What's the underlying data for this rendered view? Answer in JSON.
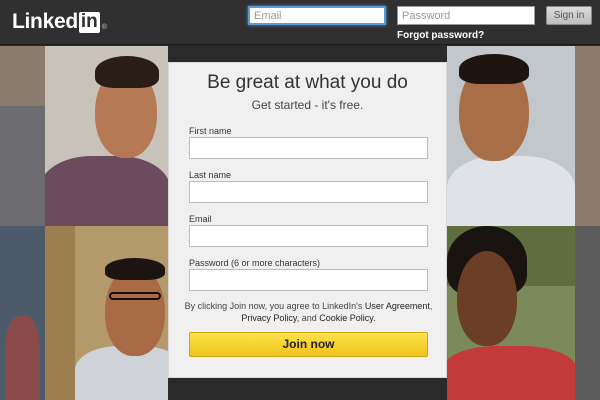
{
  "header": {
    "logo_text": "Linked",
    "logo_in": "in",
    "logo_reg": "®",
    "email_placeholder": "Email",
    "password_placeholder": "Password",
    "signin_label": "Sign in",
    "forgot_label": "Forgot password?"
  },
  "signup": {
    "title": "Be great at what you do",
    "subtitle": "Get started - it's free.",
    "fields": [
      {
        "label": "First name",
        "value": ""
      },
      {
        "label": "Last name",
        "value": ""
      },
      {
        "label": "Email",
        "value": ""
      },
      {
        "label": "Password (6 or more characters)",
        "value": ""
      }
    ],
    "terms_prefix": "By clicking Join now, you agree to LinkedIn's ",
    "terms_user_agreement": "User Agreement",
    "terms_comma": ",",
    "terms_privacy": "Privacy Policy",
    "terms_and": ", and ",
    "terms_cookie": "Cookie Policy",
    "terms_end": ".",
    "join_label": "Join now"
  },
  "colors": {
    "header_bg": "#303030",
    "join_button": "#f0c21a",
    "card_bg": "#f0f0f0"
  }
}
